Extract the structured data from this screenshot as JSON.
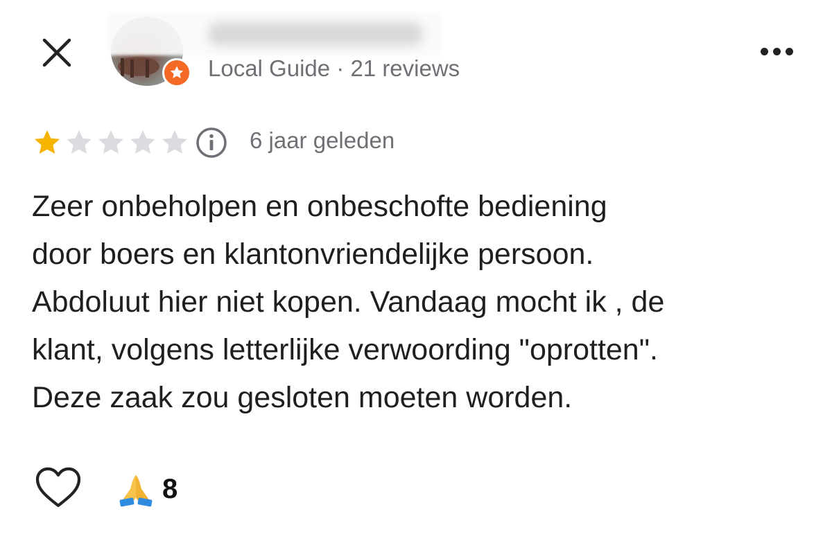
{
  "header": {
    "close_icon": "close-icon",
    "more_icon": "more-horizontal-icon"
  },
  "reviewer": {
    "meta": "Local Guide · 21 reviews",
    "badge_icon": "local-guide-star-icon",
    "badge_color": "#f46a25"
  },
  "rating": {
    "stars": 1,
    "max": 5,
    "filled_color": "#f5b400",
    "empty_color": "#dadce0",
    "info_icon": "info-icon",
    "time": "6 jaar geleden"
  },
  "review": {
    "lines": [
      "Zeer onbeholpen en onbeschofte bediening",
      "door boers en klantonvriendelijke persoon.",
      "Abdoluut hier niet kopen. Vandaag mocht ik , de",
      "klant, volgens letterlijke verwoording \"oprotten\".",
      "Deze zaak zou gesloten moeten worden."
    ]
  },
  "actions": {
    "like_icon": "heart-outline-icon",
    "reaction_emoji": "🙏",
    "reaction_count": "8"
  }
}
